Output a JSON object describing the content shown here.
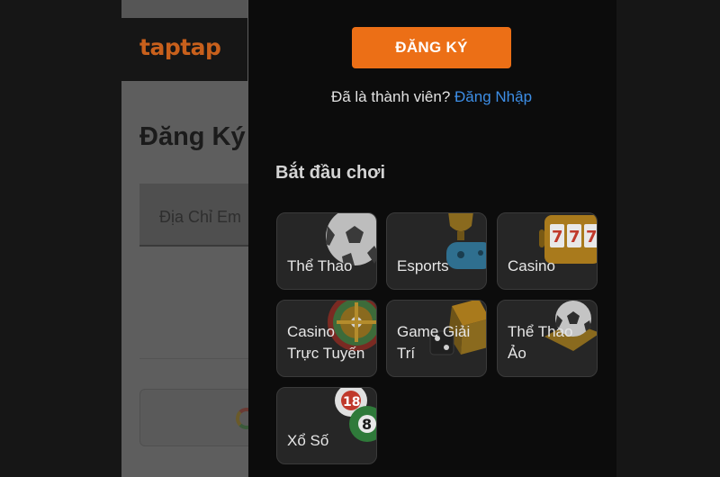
{
  "background_page": {
    "logo_text": "taptap",
    "title": "Đăng Ký",
    "email_placeholder": "Địa Chỉ Em"
  },
  "drawer": {
    "signup_label": "ĐĂNG KÝ",
    "member_prompt": "Đã là thành viên?",
    "login_link": "Đăng Nhập",
    "section_title": "Bắt đầu chơi",
    "tiles": [
      {
        "label_line1": "Thể Thao",
        "label_line2": "",
        "icon": "soccer-ball-icon"
      },
      {
        "label_line1": "Esports",
        "label_line2": "",
        "icon": "trophy-gamepad-icon"
      },
      {
        "label_line1": "Casino",
        "label_line2": "",
        "icon": "slot-machine-icon"
      },
      {
        "label_line1": "Casino",
        "label_line2": "Trực Tuyến",
        "icon": "roulette-icon"
      },
      {
        "label_line1": "Game Giải",
        "label_line2": "Trí",
        "icon": "dice-icon"
      },
      {
        "label_line1": "Thể Thao",
        "label_line2": "Ảo",
        "icon": "virtual-soccer-icon"
      },
      {
        "label_line1": "Xổ Số",
        "label_line2": "",
        "icon": "lottery-balls-icon"
      }
    ]
  },
  "colors": {
    "accent": "#ec6f16",
    "link": "#3d8ee6",
    "drawer_bg": "#0c0c0c",
    "tile_bg": "#262626"
  }
}
